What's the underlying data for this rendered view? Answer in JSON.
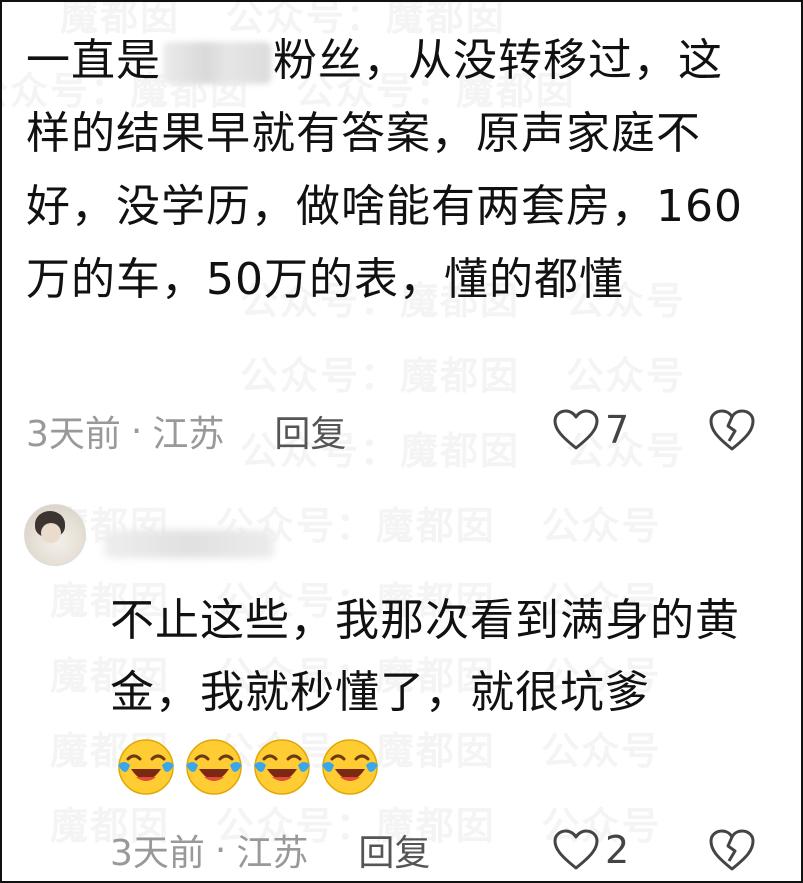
{
  "watermark_text": "魔都囡   公众号：魔都囡",
  "comment1": {
    "text_part1": "一直是",
    "text_part2": "粉丝，从没转移过，这样的结果早就有答案，原声家庭不好，没学历，做啥能有两套房，160万的车，50万的表，懂的都懂",
    "time": "3天前",
    "separator": "·",
    "location": "江苏",
    "reply_label": "回复",
    "like_count": "7"
  },
  "comment2": {
    "text": "不止这些，我那次看到满身的黄金，我就秒懂了，就很坑爹",
    "emojis": [
      "laugh-cry-emoji",
      "laugh-cry-emoji",
      "laugh-cry-emoji",
      "laugh-cry-emoji"
    ],
    "time": "3天前",
    "separator": "·",
    "location": "江苏",
    "reply_label": "回复",
    "like_count": "2"
  },
  "icons": {
    "like": "heart-outline-icon",
    "dislike": "broken-heart-icon"
  },
  "colors": {
    "text": "#111111",
    "meta_text": "#999999",
    "emoji_face": "#ffcc33",
    "emoji_tear": "#3ca7e8"
  }
}
